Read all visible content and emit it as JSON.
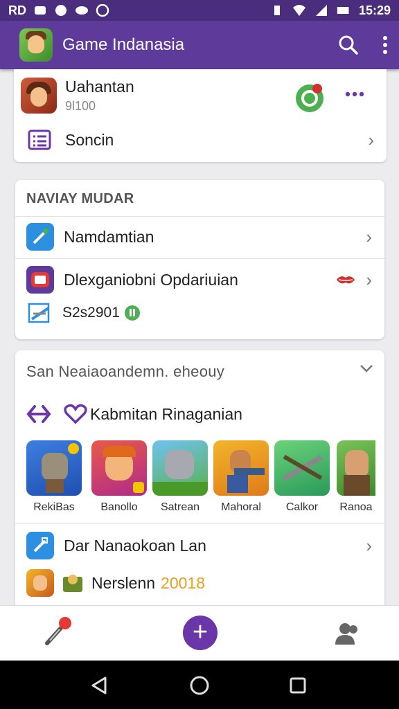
{
  "status_bar": {
    "left_text": "RD",
    "time": "15:29"
  },
  "app_bar": {
    "title": "Game Indanasia"
  },
  "profile_card": {
    "name": "Uahantan",
    "subtitle": "9l100",
    "link_label": "Soncin"
  },
  "section1": {
    "title": "NAVIAY MUDAR",
    "item1_label": "Namdamtian",
    "item2_label": "Dlexganiobni  Opdariuian",
    "item3_label": "S2s2901"
  },
  "section2": {
    "title": "San Neaiaoandemn. eheouy",
    "sub_label": "Kabmitan Rinaganian",
    "games": [
      {
        "label": "RekiBas"
      },
      {
        "label": "Banollo"
      },
      {
        "label": "Satrean"
      },
      {
        "label": "Mahoral"
      },
      {
        "label": "Calkor"
      },
      {
        "label": "Ranoa"
      }
    ],
    "row_label": "Dar Nanaokoan Lan",
    "last_label": "Nerslenn",
    "last_year": "20018"
  },
  "colors": {
    "primary": "#5e3a9a",
    "status": "#4a2d7c",
    "accent_green": "#4caf50",
    "accent_red": "#d32f2f"
  }
}
